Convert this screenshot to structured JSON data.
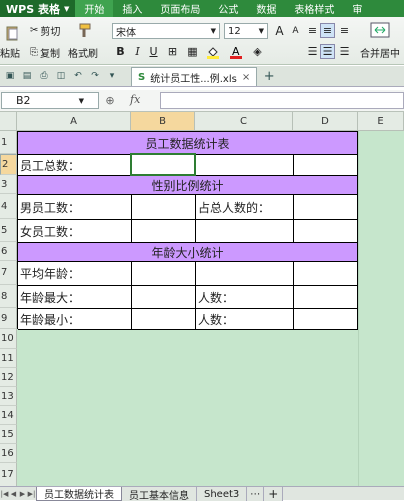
{
  "app": {
    "name": "WPS 表格"
  },
  "menu": [
    "开始",
    "插入",
    "页面布局",
    "公式",
    "数据",
    "表格样式",
    "审"
  ],
  "ribbon": {
    "paste": "粘贴",
    "cut": "剪切",
    "copy": "复制",
    "format_painter": "格式刷",
    "font": "宋体",
    "size": "12",
    "merge": "合并居中"
  },
  "document_tab": "统计员工性...例.xls",
  "namebox": "B2",
  "fx": "fx",
  "columns": [
    "A",
    "B",
    "C",
    "D",
    "E"
  ],
  "rows": [
    "1",
    "2",
    "3",
    "4",
    "5",
    "6",
    "7",
    "8",
    "9",
    "10",
    "11",
    "12",
    "13",
    "14",
    "15",
    "16",
    "17"
  ],
  "cells": {
    "title1": "员工数据统计表",
    "total": "员工总数：",
    "title2": "性别比例统计",
    "male": "男员工数：",
    "ratio": "占总人数的：",
    "female": "女员工数：",
    "title3": "年龄大小统计",
    "avg_age": "平均年龄：",
    "oldest": "年龄最大：",
    "count1": "人数：",
    "youngest": "年龄最小：",
    "count2": "人数："
  },
  "sheets": [
    "员工数据统计表",
    "员工基本信息",
    "Sheet3"
  ],
  "colors": {
    "header_fill": "#cc99ff",
    "grid_bg": "#c6e6cc",
    "menu_green": "#2e8a3c"
  }
}
